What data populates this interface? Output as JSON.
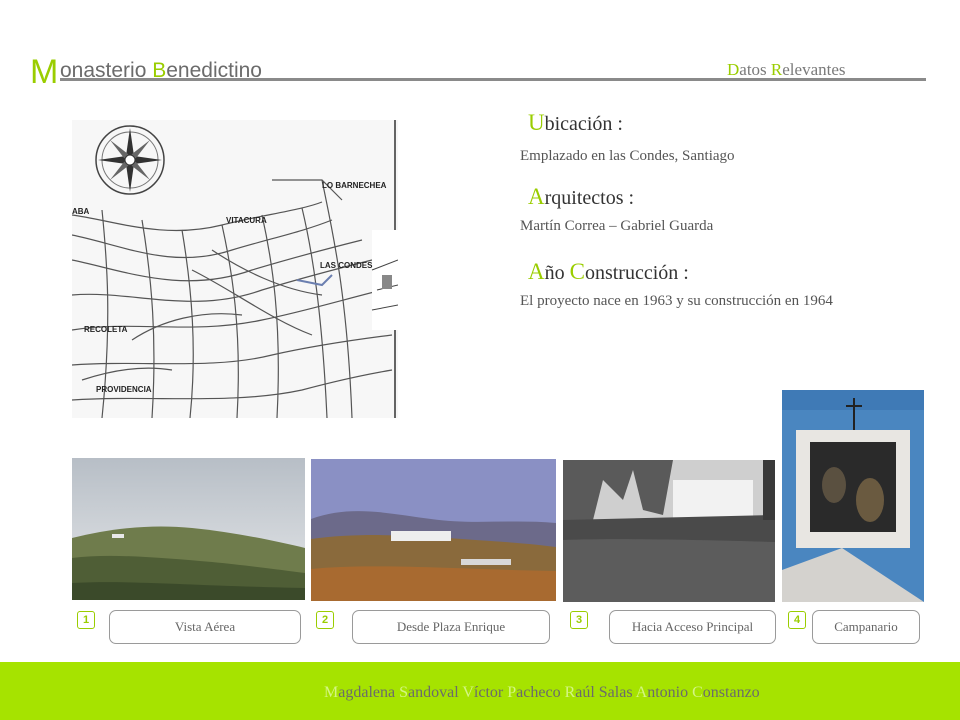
{
  "header": {
    "title_initial": "M",
    "title_rest_1": "onasterio ",
    "title_initial_2": "B",
    "title_rest_2": "enedictino",
    "section_initial_1": "D",
    "section_rest_1": "atos ",
    "section_initial_2": "R",
    "section_rest_2": "elevantes"
  },
  "info": [
    {
      "heading_parts": [
        "U",
        "bicación :"
      ],
      "text": "Emplazado en las Condes, Santiago"
    },
    {
      "heading_parts": [
        "A",
        "rquitectos :"
      ],
      "text": "Martín Correa – Gabriel Guarda"
    },
    {
      "heading_parts": [
        "A",
        "ño ",
        "C",
        "onstrucción :"
      ],
      "text": "El proyecto nace en 1963 y su construcción en 1964"
    }
  ],
  "map": {
    "labels": [
      "LO BARNECHEA",
      "VITACURA",
      "LAS CONDES",
      "RECOLETA",
      "PROVIDENCIA",
      "ABA"
    ]
  },
  "photos": [
    {
      "number": "1",
      "caption": "Vista Aérea"
    },
    {
      "number": "2",
      "caption": "Desde Plaza Enrique"
    },
    {
      "number": "3",
      "caption": "Hacia Acceso Principal"
    },
    {
      "number": "4",
      "caption": "Campanario"
    }
  ],
  "footer": {
    "authors_parts": [
      "M",
      "agdalena ",
      "S",
      "andoval ",
      "V",
      "íctor ",
      "P",
      "acheco ",
      "R",
      "aúl Salas ",
      "A",
      "ntonio ",
      "C",
      "onstanzo"
    ]
  },
  "colors": {
    "accent": "#9acd00",
    "footer_bg": "#a6e300",
    "rule": "#8a8a8a"
  }
}
